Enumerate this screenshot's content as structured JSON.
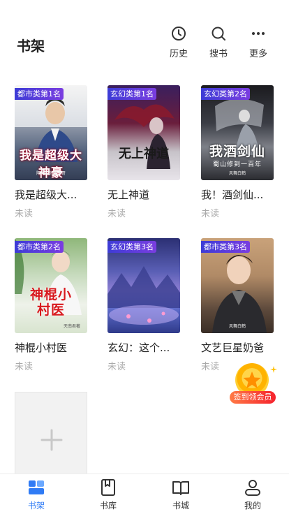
{
  "header": {
    "title": "书架",
    "actions": [
      {
        "label": "历史",
        "icon": "clock-icon"
      },
      {
        "label": "搜书",
        "icon": "search-icon"
      },
      {
        "label": "更多",
        "icon": "more-icon"
      }
    ]
  },
  "books": [
    {
      "rank": "都市类第1名",
      "title": "我是超级大...",
      "status": "未读",
      "cover_title": "我是超级大神豪",
      "cover_author": "隔壁的邻居大哥"
    },
    {
      "rank": "玄幻类第1名",
      "title": "无上神道",
      "status": "未读",
      "cover_title": "无上神道"
    },
    {
      "rank": "玄幻类第2名",
      "title": "我！酒剑仙...",
      "status": "未读",
      "cover_title": "我酒剑仙",
      "cover_subtitle": "蜀山修到一百年",
      "cover_author": "风舞白鹤"
    },
    {
      "rank": "都市类第2名",
      "title": "神棍小村医",
      "status": "未读",
      "cover_title": "神棍小村医",
      "cover_author": "天南君著"
    },
    {
      "rank": "玄幻类第3名",
      "title": "玄幻：这个...",
      "status": "未读"
    },
    {
      "rank": "都市类第3名",
      "title": "文艺巨星奶爸",
      "status": "未读",
      "cover_author": "风舞白鹤"
    }
  ],
  "add_tile": {
    "icon": "plus-icon"
  },
  "promo": {
    "label": "签到领会员",
    "icon": "star-coin-icon"
  },
  "tabbar": {
    "active": "书架",
    "tabs": [
      {
        "label": "书架",
        "icon": "bookshelf-icon"
      },
      {
        "label": "书库",
        "icon": "book-library-icon"
      },
      {
        "label": "书城",
        "icon": "open-book-icon"
      },
      {
        "label": "我的",
        "icon": "user-icon"
      }
    ]
  },
  "colors": {
    "accent": "#2f7bf5",
    "rank_tag": "#4b3ce0",
    "promo": "#f5222d"
  }
}
